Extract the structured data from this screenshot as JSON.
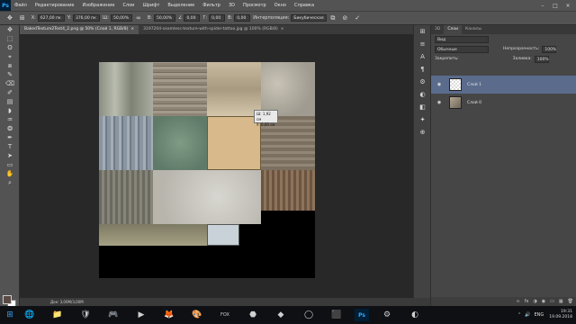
{
  "app": {
    "logo": "Ps"
  },
  "menu": [
    "Файл",
    "Редактирование",
    "Изображение",
    "Слои",
    "Шрифт",
    "Выделение",
    "Фильтр",
    "3D",
    "Просмотр",
    "Окно",
    "Справка"
  ],
  "window_controls": [
    "–",
    "□",
    "×"
  ],
  "options": {
    "x_label": "X:",
    "x_value": "627,00 пк",
    "y_label": "Y:",
    "y_value": "376,00 пк",
    "w_label": "Ш:",
    "w_value": "50,00%",
    "h_label": "В:",
    "h_value": "50,00%",
    "angle_label": "∠",
    "angle_value": "0,00",
    "hskew_label": "Г:",
    "hskew_value": "0,00",
    "vskew_label": "В:",
    "vskew_value": "0,00",
    "interp_label": "Интерполяция:",
    "interp_value": "Бикубическая"
  },
  "tabs": [
    {
      "label": "BakedTexture2Test4_2.png @ 50% (Слой 1, RGB/8)",
      "close": "×"
    },
    {
      "label": "3197204-seamless-texture-with-spider-tattoo.jpg @ 100% (RGB/8)",
      "close": "×"
    }
  ],
  "tooltip": {
    "line1": "Ш: 1,92 см",
    "line2": "У: 0,00 см"
  },
  "status": {
    "text": "Док: 3,00М/3,00М"
  },
  "tools": [
    "✥",
    "⬚",
    "ʘ",
    "⌖",
    "⧈",
    "✎",
    "⌫",
    "✐",
    "▤",
    "◗",
    "♒",
    "❂",
    "✒",
    "T",
    "➤",
    "▭",
    "✋",
    "⌕"
  ],
  "right_strip": [
    "⊞",
    "≡",
    "A",
    "¶",
    "⚙",
    "◐",
    "◧",
    "✦",
    "⊕"
  ],
  "layers_panel": {
    "tabs": [
      "3D",
      "Слои",
      "Каналы"
    ],
    "search": "Вид",
    "blend": "Обычные",
    "opacity_label": "Непрозрачность:",
    "opacity_value": "100%",
    "lock_label": "Закрепить:",
    "fill_label": "Заливка:",
    "fill_value": "100%",
    "layers": [
      {
        "name": "Слой 1",
        "selected": true
      },
      {
        "name": "Слой 0",
        "selected": false
      }
    ],
    "bottom_icons": [
      "∞",
      "fx",
      "◑",
      "◉",
      "▭",
      "▦",
      "🗑"
    ]
  },
  "taskbar": {
    "apps": [
      "🌐",
      "📁",
      "🛡",
      "🎮",
      "▶",
      "🦊",
      "🎨",
      "FOX",
      "⬣",
      "◆",
      "◯",
      "⬛",
      "Ps",
      "⚙",
      "◐"
    ],
    "lang": "ENG",
    "time": "19:31",
    "date": "19.09.2018"
  }
}
